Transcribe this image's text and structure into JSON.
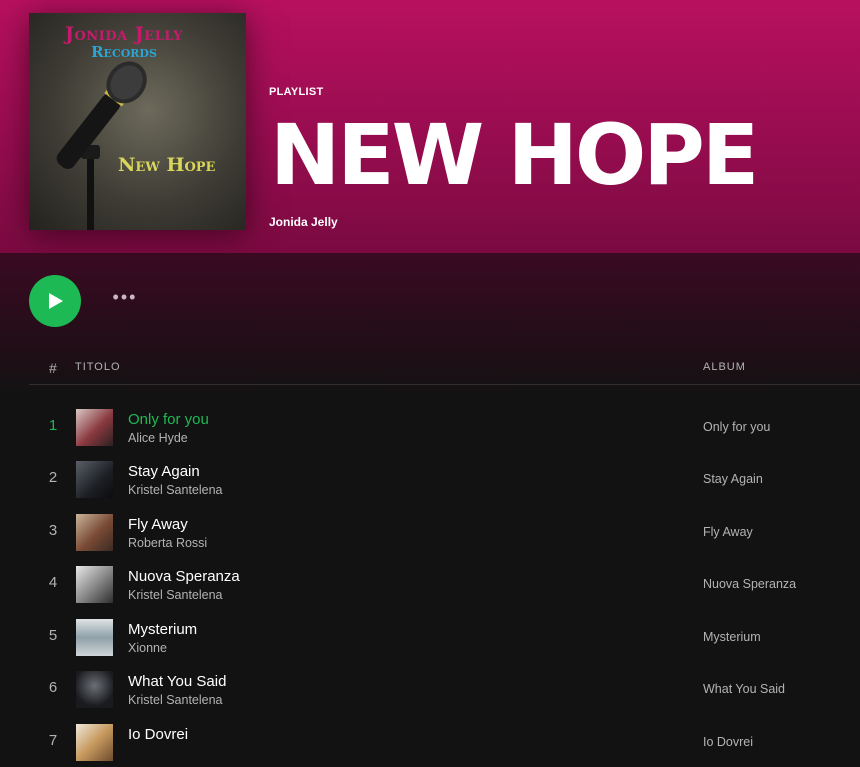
{
  "colors": {
    "accent": "#1db954",
    "header": "#b8105f",
    "background": "#121212"
  },
  "header": {
    "type": "PLAYLIST",
    "title": "NEW HOPE",
    "owner": "Jonida Jelly",
    "cover": {
      "line1": "Jonida Jelly",
      "line2": "Records",
      "line3": "New Hope"
    }
  },
  "actions": {
    "play_icon": "play-icon",
    "more_label": "•••"
  },
  "table": {
    "col_num": "#",
    "col_title": "TITOLO",
    "col_album": "ALBUM",
    "rows": [
      {
        "num": "1",
        "title": "Only for you",
        "artist": "Alice Hyde",
        "album": "Only for you",
        "active": true
      },
      {
        "num": "2",
        "title": "Stay Again",
        "artist": "Kristel Santelena",
        "album": "Stay Again"
      },
      {
        "num": "3",
        "title": "Fly Away",
        "artist": "Roberta Rossi",
        "album": "Fly Away"
      },
      {
        "num": "4",
        "title": "Nuova Speranza",
        "artist": "Kristel Santelena",
        "album": "Nuova Speranza"
      },
      {
        "num": "5",
        "title": "Mysterium",
        "artist": "Xionne",
        "album": "Mysterium"
      },
      {
        "num": "6",
        "title": "What You Said",
        "artist": "Kristel Santelena",
        "album": "What You Said"
      },
      {
        "num": "7",
        "title": "Io Dovrei",
        "artist": "",
        "album": "Io Dovrei"
      }
    ]
  }
}
